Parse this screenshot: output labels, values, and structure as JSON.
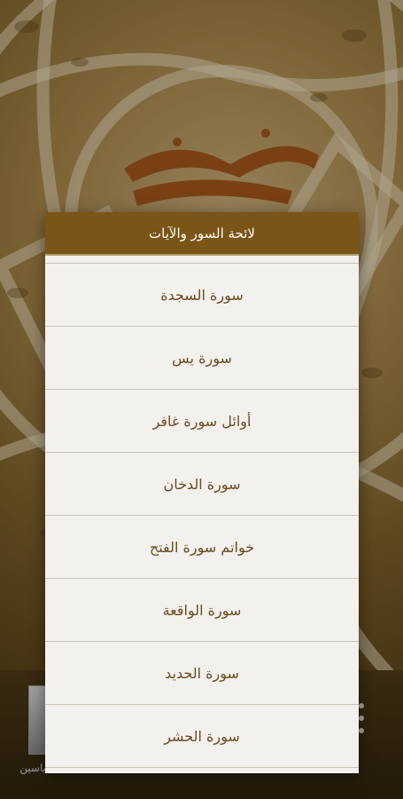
{
  "dialog": {
    "title": "لائحة السور والآيات",
    "items": [
      {
        "label": "سورة السجدة"
      },
      {
        "label": "سورة يس"
      },
      {
        "label": "أوائل سورة غافر"
      },
      {
        "label": "سورة الدخان"
      },
      {
        "label": "خواتم سورة الفتح"
      },
      {
        "label": "سورة الواقعة"
      },
      {
        "label": "سورة الحديد"
      },
      {
        "label": "سورة الحشر"
      }
    ]
  },
  "player": {
    "reciter_name": "ياسين"
  },
  "colors": {
    "header": "#7a5516",
    "item_text": "#6d4a1b",
    "dialog_bg": "#f3f1ee"
  }
}
